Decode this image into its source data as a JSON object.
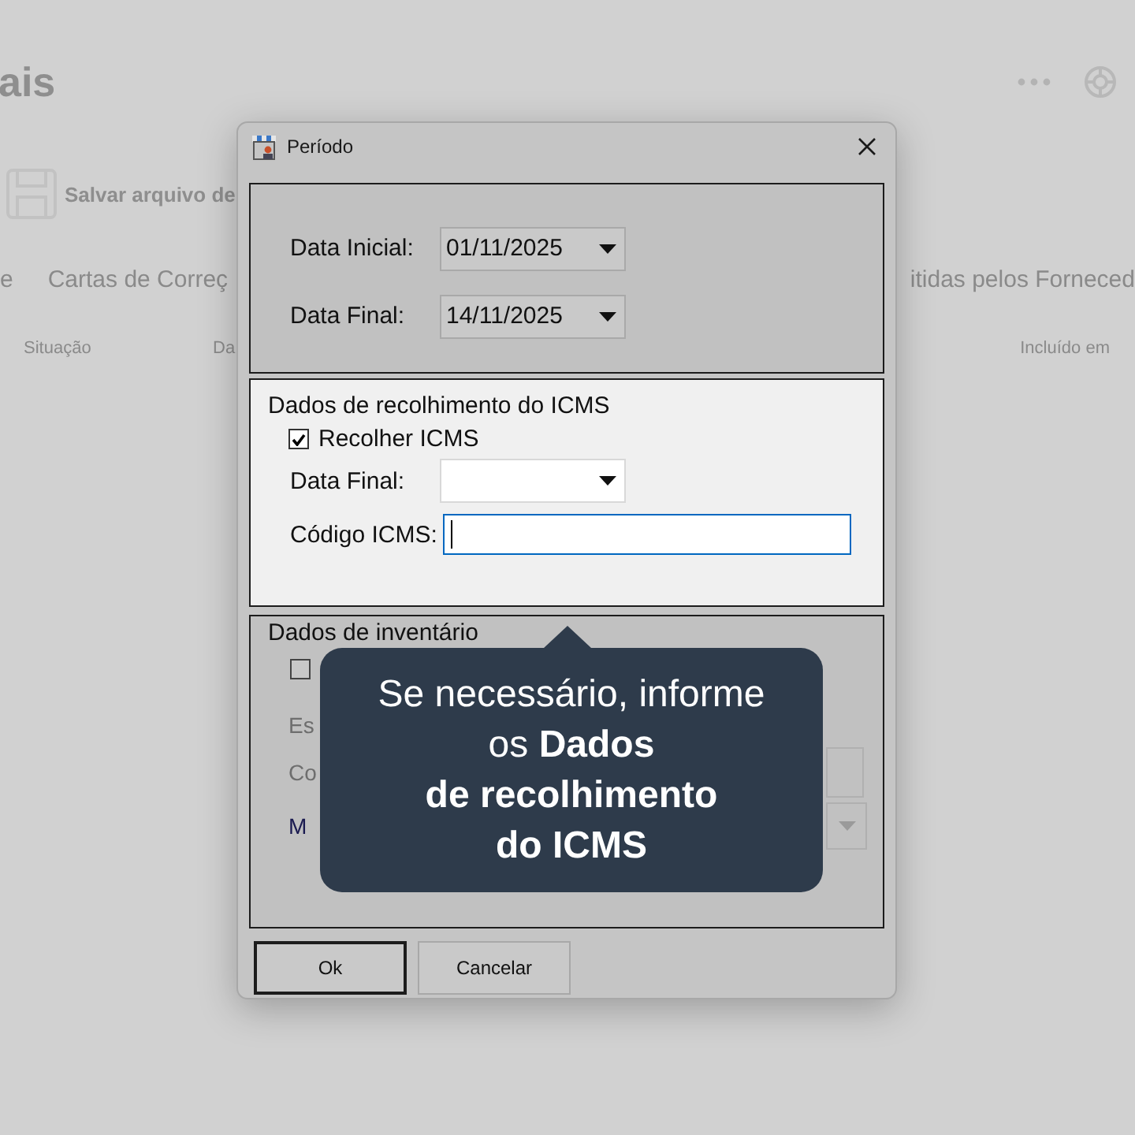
{
  "background": {
    "heading": "ais",
    "save_button": "Salvar arquivo de",
    "tabs": [
      {
        "label": "e"
      },
      {
        "label": "Cartas de Correç"
      },
      {
        "label": "itidas pelos Forneced"
      }
    ],
    "columns": [
      "Situação",
      "Da",
      "Incluído em"
    ]
  },
  "dialog": {
    "title": "Período",
    "period": [
      {
        "label": "Data Inicial:",
        "value": "01/11/2025"
      },
      {
        "label": "Data Final:",
        "value": "14/11/2025"
      }
    ],
    "icms": {
      "title": "Dados de recolhimento do ICMS",
      "checkbox": {
        "label": "Recolher ICMS",
        "checked": true
      },
      "date_label": "Data Final:",
      "code_label": "Código ICMS:",
      "code_focused": true
    },
    "inventory": {
      "title": "Dados de inventário",
      "checkbox": {
        "checked": false
      },
      "labels": [
        "Es",
        "Co",
        "M"
      ]
    },
    "buttons": [
      {
        "label": "Ok",
        "default": true
      },
      {
        "label": "Cancelar",
        "default": false
      }
    ]
  },
  "tooltip": {
    "lines": [
      "Se necessário, informe",
      "os **Dados**",
      "**de recolhimento**",
      "**do ICMS**"
    ]
  }
}
